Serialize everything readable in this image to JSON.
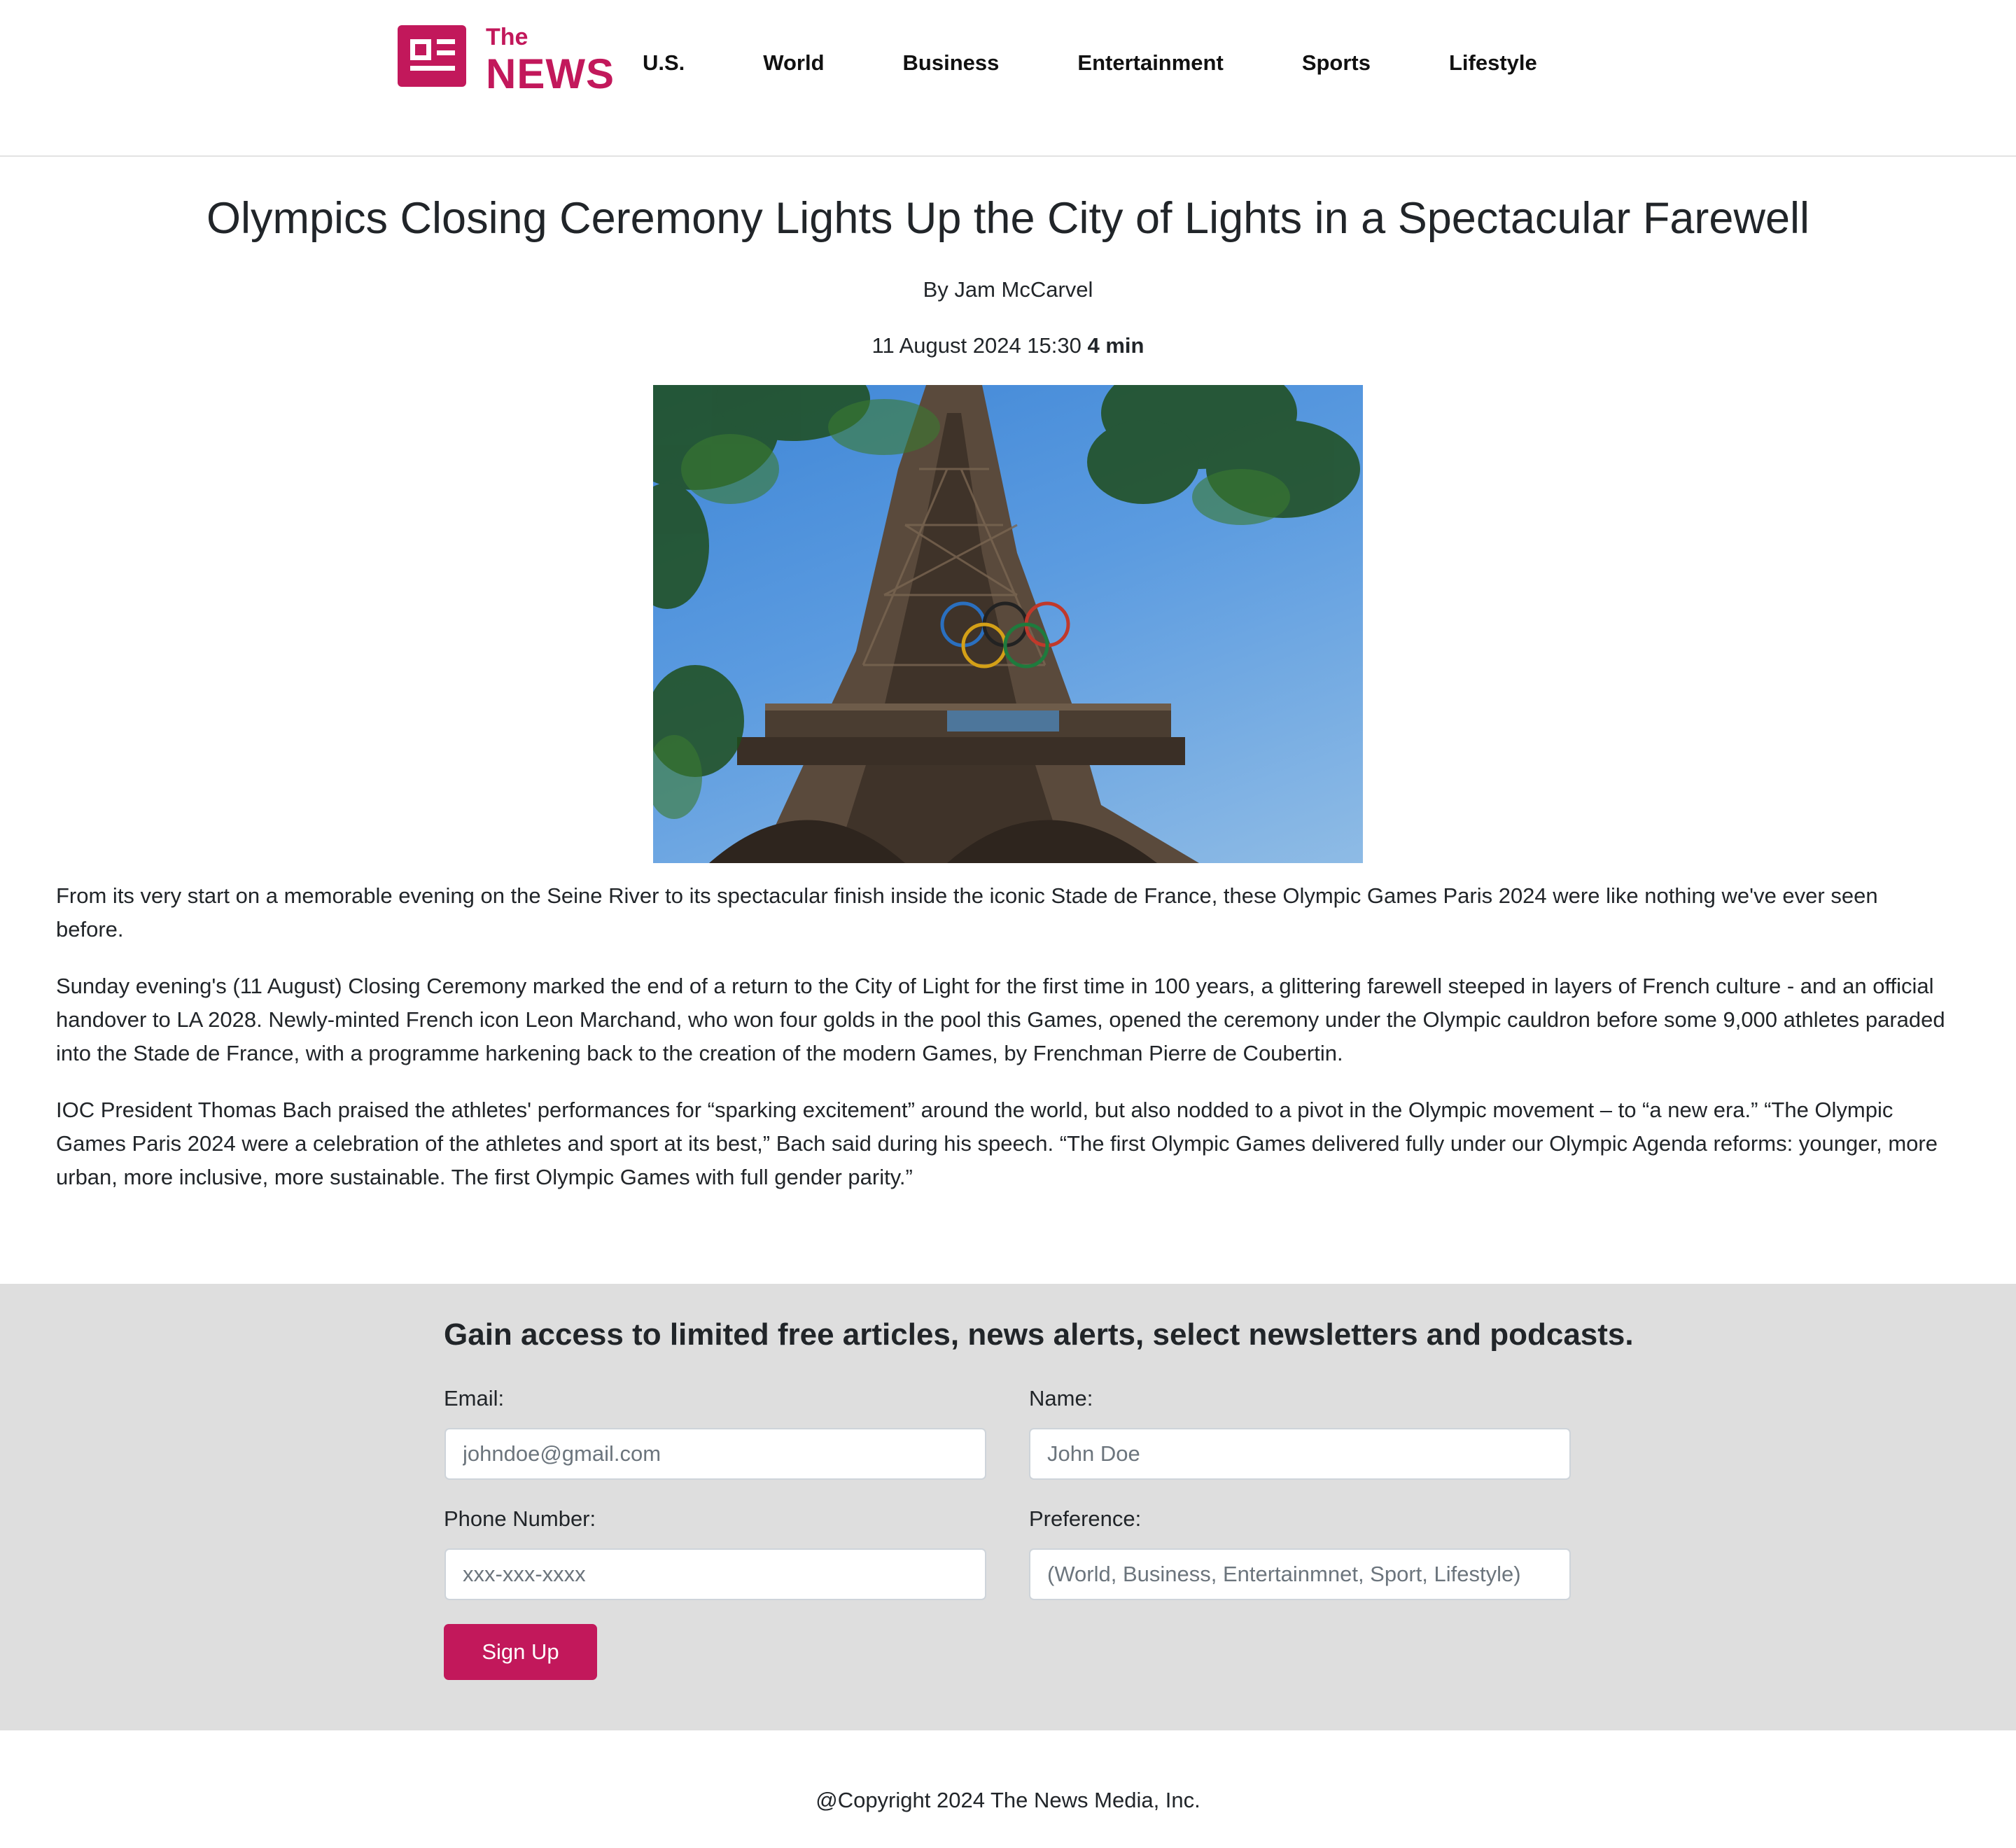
{
  "header": {
    "logo": {
      "top": "The",
      "bottom": "NEWS",
      "color": "#c2185b"
    },
    "nav": [
      {
        "label": "U.S."
      },
      {
        "label": "World"
      },
      {
        "label": "Business"
      },
      {
        "label": "Entertainment"
      },
      {
        "label": "Sports"
      },
      {
        "label": "Lifestyle"
      }
    ]
  },
  "article": {
    "title": "Olympics Closing Ceremony Lights Up the City of Lights in a Spectacular Farewell",
    "byline": "By Jam McCarvel",
    "date": "11 August 2024 15:30",
    "read_time": "4 min",
    "image_description": "eiffel-tower-olympic-rings-photo",
    "paragraphs": [
      "From its very start on a memorable evening on the Seine River to its spectacular finish inside the iconic Stade de France, these Olympic Games Paris 2024 were like nothing we've ever seen before.",
      "Sunday evening's (11 August) Closing Ceremony marked the end of a return to the City of Light for the first time in 100 years, a glittering farewell steeped in layers of French culture - and an official handover to LA 2028. Newly-minted French icon Leon Marchand, who won four golds in the pool this Games, opened the ceremony under the Olympic cauldron before some 9,000 athletes paraded into the Stade de France, with a programme harkening back to the creation of the modern Games, by Frenchman Pierre de Coubertin.",
      "IOC President Thomas Bach praised the athletes' performances for “sparking excitement” around the world, but also nodded to a pivot in the Olympic movement – to “a new era.” “The Olympic Games Paris 2024 were a celebration of the athletes and sport at its best,” Bach said during his speech. “The first Olympic Games delivered fully under our Olympic Agenda reforms: younger, more urban, more inclusive, more sustainable. The first Olympic Games with full gender parity.”"
    ]
  },
  "signup": {
    "heading": "Gain access to limited free articles, news alerts, select newsletters and podcasts.",
    "email_label": "Email:",
    "email_placeholder": "johndoe@gmail.com",
    "name_label": "Name:",
    "name_placeholder": "John Doe",
    "phone_label": "Phone Number:",
    "phone_placeholder": "xxx-xxx-xxxx",
    "preference_label": "Preference:",
    "preference_placeholder": "(World, Business, Entertainmnet, Sport, Lifestyle)",
    "button_label": "Sign Up",
    "background": "#dedede"
  },
  "footer": {
    "copyright": "@Copyright 2024 The News Media, Inc."
  }
}
